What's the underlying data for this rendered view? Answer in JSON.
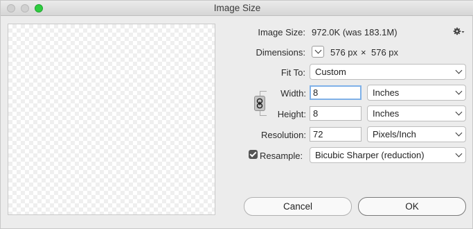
{
  "window": {
    "title": "Image Size"
  },
  "info": {
    "image_size_label": "Image Size:",
    "image_size_value": "972.0K (was 183.1M)",
    "dimensions_label": "Dimensions:",
    "dim_width": "576 px",
    "dim_x": "×",
    "dim_height": "576 px"
  },
  "fit_to": {
    "label": "Fit To:",
    "value": "Custom"
  },
  "width": {
    "label": "Width:",
    "value": "8",
    "unit": "Inches"
  },
  "height": {
    "label": "Height:",
    "value": "8",
    "unit": "Inches"
  },
  "resolution": {
    "label": "Resolution:",
    "value": "72",
    "unit": "Pixels/Inch"
  },
  "resample": {
    "label": "Resample:",
    "checked": true,
    "value": "Bicubic Sharper (reduction)"
  },
  "buttons": {
    "cancel": "Cancel",
    "ok": "OK"
  },
  "icons": {
    "settings": "gear-icon",
    "link": "link-chain-icon",
    "dimensions_toggle": "chevron-down-icon"
  },
  "colors": {
    "zoom_button": "#2ecc3f",
    "focus_ring": "#7fb1e8"
  }
}
